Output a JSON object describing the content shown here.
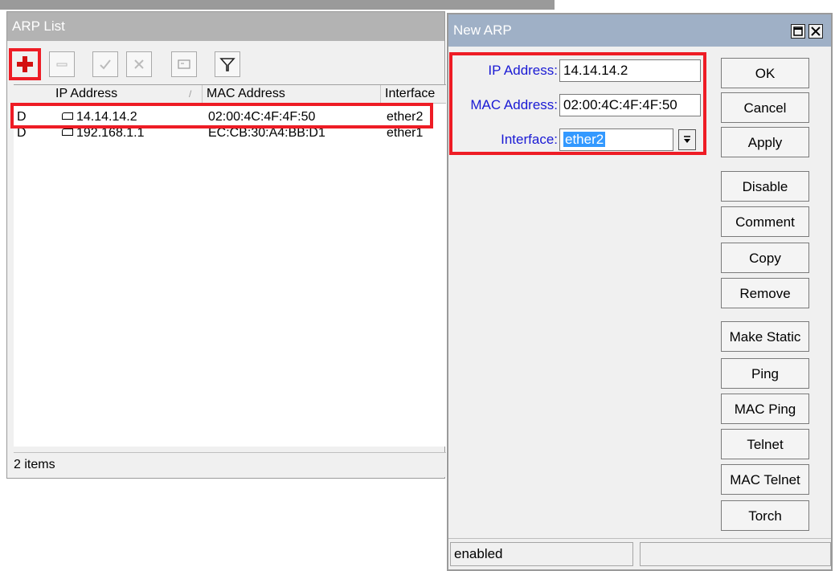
{
  "arp_list": {
    "title": "ARP List",
    "toolbar": [
      {
        "name": "add-button",
        "icon": "plus-icon"
      },
      {
        "name": "remove-button",
        "icon": "minus-icon"
      },
      {
        "name": "enable-button",
        "icon": "check-icon"
      },
      {
        "name": "disable-button",
        "icon": "cross-icon"
      },
      {
        "name": "comment-button",
        "icon": "note-icon"
      },
      {
        "name": "filter-button",
        "icon": "filter-icon"
      }
    ],
    "columns": [
      "IP Address",
      "MAC Address",
      "Interface"
    ],
    "rows": [
      {
        "flag": "D",
        "ip": "14.14.14.2",
        "mac": "02:00:4C:4F:4F:50",
        "iface": "ether2"
      },
      {
        "flag": "D",
        "ip": "192.168.1.1",
        "mac": "EC:CB:30:A4:BB:D1",
        "iface": "ether1"
      }
    ],
    "status": "2 items"
  },
  "new_arp": {
    "title": "New ARP",
    "fields": {
      "ip_label": "IP Address:",
      "ip_value": "14.14.14.2",
      "mac_label": "MAC Address:",
      "mac_value": "02:00:4C:4F:4F:50",
      "iface_label": "Interface:",
      "iface_value": "ether2"
    },
    "buttons": [
      "OK",
      "Cancel",
      "Apply",
      "Disable",
      "Comment",
      "Copy",
      "Remove",
      "Make Static",
      "Ping",
      "MAC Ping",
      "Telnet",
      "MAC Telnet",
      "Torch"
    ],
    "status": "enabled"
  },
  "colors": {
    "highlight": "#ee1c25",
    "dialog_title": "#9fb0c6",
    "label_blue": "#1a1ad4",
    "selection": "#3399ff"
  }
}
